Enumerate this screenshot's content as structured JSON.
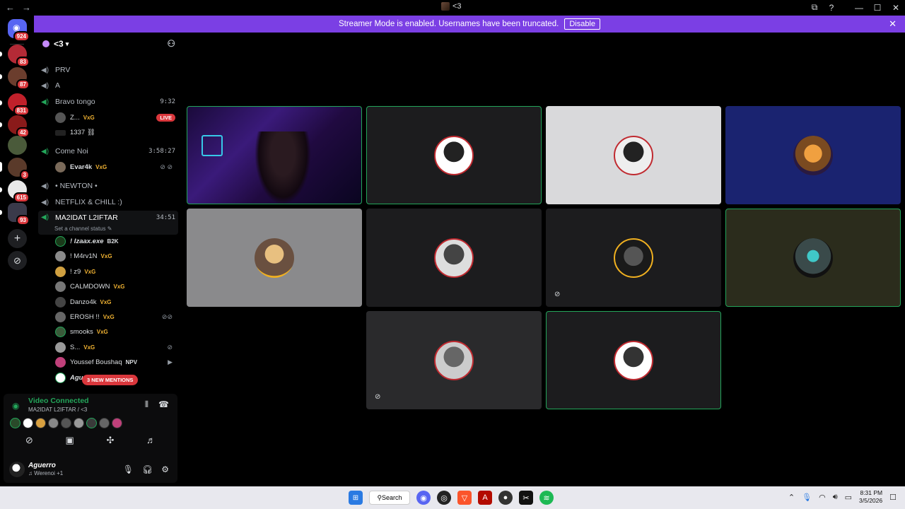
{
  "titlebar": {
    "back": "←",
    "forward": "→",
    "title": "<3",
    "icons": [
      "screen-share-icon",
      "help-icon"
    ],
    "minimize": "—",
    "maximize": "☐",
    "close": "✕"
  },
  "banner": {
    "text": "Streamer Mode is enabled. Usernames have been truncated.",
    "button": "Disable",
    "close": "✕"
  },
  "servers": [
    {
      "name": "home",
      "badge": "924",
      "color": "#5865f2"
    },
    {
      "name": "server-1",
      "badge": "83",
      "color": "#b42a36"
    },
    {
      "name": "server-2",
      "badge": "87",
      "color": "#6b3d2d"
    },
    {
      "name": "server-3",
      "badge": "831",
      "color": "#c0202a"
    },
    {
      "name": "server-4",
      "badge": "42",
      "color": "#8a1a1a"
    },
    {
      "name": "server-5",
      "badge": "",
      "color": "#4a5a3a"
    },
    {
      "name": "server-6",
      "badge": "3",
      "color": "#5a3a2a"
    },
    {
      "name": "server-7",
      "badge": "615",
      "color": "#e8e8e8"
    },
    {
      "name": "server-8",
      "badge": "93",
      "color": "#3a3a4a"
    }
  ],
  "guild": {
    "name": "<3",
    "chevron": "▾"
  },
  "channels": [
    {
      "name": "PRV",
      "time": ""
    },
    {
      "name": "A",
      "time": ""
    },
    {
      "name": "Bravo tongo",
      "time": "9:32"
    },
    {
      "name": "Come Noi",
      "time": "3:58:27"
    },
    {
      "name": "• NEWTON •",
      "time": ""
    },
    {
      "name": "NETFLIX & CHILL :)",
      "time": ""
    },
    {
      "name": "MA2IDAT L2IFTAR",
      "time": "34:51"
    }
  ],
  "channel_status": "Set a channel status",
  "live_label": "LIVE",
  "bravo_members": [
    {
      "name": "Z...",
      "tag": "VxG"
    },
    {
      "name": "1337 ⛓",
      "tag": ""
    }
  ],
  "come_members": [
    {
      "name": "Evar4k",
      "tag": "VxG"
    }
  ],
  "members": [
    {
      "name": "! Izaax.exe",
      "tag": "B2K",
      "icon": ""
    },
    {
      "name": "! M4rv1N",
      "tag": "VxG",
      "icon": ""
    },
    {
      "name": "! z9",
      "tag": "VxG",
      "icon": ""
    },
    {
      "name": "CALMDOWN",
      "tag": "VxG",
      "icon": ""
    },
    {
      "name": "Danzo4k",
      "tag": "VxG",
      "icon": ""
    },
    {
      "name": "EROSH !!",
      "tag": "VxG",
      "icon": "⊘⊘"
    },
    {
      "name": "smooks",
      "tag": "VxG",
      "icon": ""
    },
    {
      "name": "S...",
      "tag": "VxG",
      "icon": "⊘"
    },
    {
      "name": "Youssef Boushaq",
      "tag": "NPV",
      "icon": "▶"
    },
    {
      "name": "Agu",
      "tag": "",
      "icon": ""
    }
  ],
  "mentions": "3 NEW MENTIONS",
  "voice": {
    "title": "Video Connected",
    "sub": "MA2IDAT L2IFTAR / <3"
  },
  "user": {
    "name": "Aguerro",
    "status": "♫ Werenoi +1"
  },
  "taskbar": {
    "search": "Search",
    "time": "8:31 PM",
    "date": "3/5/2026"
  }
}
